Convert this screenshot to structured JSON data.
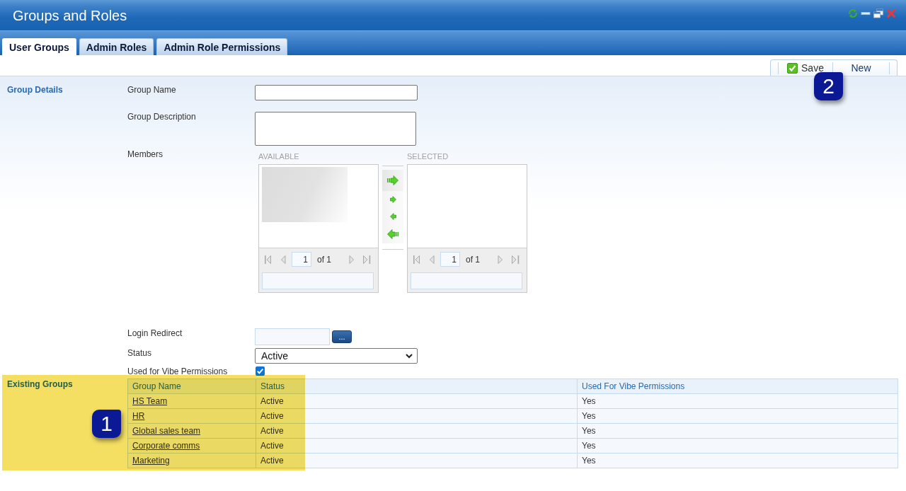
{
  "window": {
    "title": "Groups and Roles"
  },
  "tabs": [
    {
      "label": "User Groups",
      "selected": true
    },
    {
      "label": "Admin Roles",
      "selected": false
    },
    {
      "label": "Admin Role Permissions",
      "selected": false
    }
  ],
  "toolbar": {
    "buttons": [
      {
        "kind": "save",
        "label": "Save"
      },
      {
        "kind": "plain",
        "label": "New"
      }
    ],
    "callout": "2"
  },
  "group_details": {
    "heading": "Group Details",
    "group_name": {
      "label": "Group Name"
    },
    "group_description": {
      "label": "Group Description"
    },
    "members": {
      "label": "Members",
      "available": {
        "heading": "AVAILABLE",
        "loading": true,
        "page": "1",
        "page_count": "of 1"
      },
      "selected": {
        "heading": "SELECTED",
        "loading": false,
        "page": "1",
        "page_count": "of 1"
      }
    },
    "login_redirect": {
      "label": "Login Redirect",
      "button": "..."
    },
    "status": {
      "label": "Status",
      "value": "Active"
    },
    "vibe_permissions": {
      "label": "Used for Vibe Permissions",
      "checked": true
    }
  },
  "existing_groups": {
    "heading": "Existing Groups",
    "highlighted": true,
    "callout": "1",
    "table": {
      "columns": [
        "Group Name",
        "Status",
        "Used For Vibe Permissions"
      ],
      "rows": [
        [
          "HS Team",
          "Active",
          "Yes"
        ],
        [
          "HR",
          "Active",
          "Yes"
        ],
        [
          "Global sales team",
          "Active",
          "Yes"
        ],
        [
          "Corporate comms",
          "Active",
          "Yes"
        ],
        [
          "Marketing",
          "Active",
          "Yes"
        ]
      ]
    }
  }
}
